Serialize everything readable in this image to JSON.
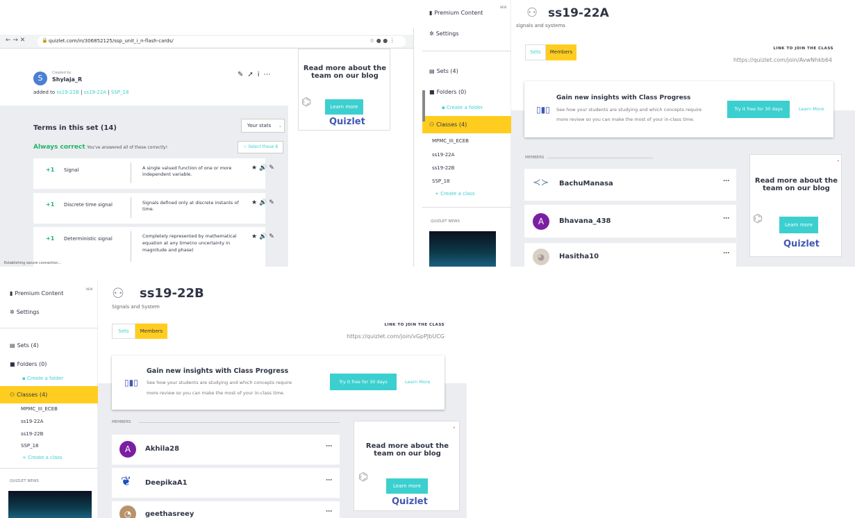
{
  "p1": {
    "url": "quizlet.com/in/306852125/ssp_unit_i_n-flash-cards/",
    "created_by": "Created by",
    "author": "Shylaja_R",
    "author_initial": "S",
    "added_to": "added to",
    "class_links": [
      "ss19-22B",
      "ss19-22A",
      "SSP_18"
    ],
    "terms_title": "Terms in this set (14)",
    "your_stats": "Your stats",
    "always_correct": "Always correct",
    "always_correct_msg": "You've answered all of these correctly!",
    "select_these": "Select these 8",
    "terms": [
      {
        "score": "+1",
        "term": "Signal",
        "def": "A single valued function of one or more independent variable."
      },
      {
        "score": "+1",
        "term": "Discrete time signal",
        "def": "Signals defined only at discrete instants of time."
      },
      {
        "score": "+1",
        "term": "Deterministic signal",
        "def": "Completely represented by mathematical equation at any time(no uncertainty in magnitude and phase)"
      }
    ],
    "status": "Establishing secure connection..."
  },
  "ad": {
    "line1": "Read more about the",
    "line2": "team on our blog",
    "learn": "Learn more",
    "brand": "Quizlet"
  },
  "sidebar": {
    "premium": "Premium Content",
    "new": "NEW",
    "settings": "Settings",
    "sets": "Sets (4)",
    "folders": "Folders (0)",
    "create_folder": "Create a folder",
    "classes": "Classes (4)",
    "class_list": [
      "MPMC_III_ECEB",
      "ss19-22A",
      "ss19-22B",
      "SSP_18"
    ],
    "create_class": "Create a class",
    "news": "QUIZLET NEWS"
  },
  "c1": {
    "title": "ss19-22A",
    "subtitle": "signals and systems",
    "sets": "Sets",
    "members": "Members",
    "join_label": "LINK TO JOIN THE CLASS",
    "join_url": "https://quizlet.com/join/AvwNhkb64",
    "banner_title": "Gain new insights with Class Progress",
    "banner_text1": "See how your students are studying and which concepts require",
    "banner_text2": "more review so you can make the most of your in-class time.",
    "try": "Try it free for 30 days",
    "learn_more": "Learn More",
    "members_label": "MEMBERS",
    "member_list": [
      {
        "name": "BachuManasa",
        "init": ""
      },
      {
        "name": "Bhavana_438",
        "init": "A"
      },
      {
        "name": "Hasitha10",
        "init": ""
      }
    ]
  },
  "c2": {
    "title": "ss19-22B",
    "subtitle": "Signals and System",
    "sets": "Sets",
    "members": "Members",
    "join_label": "LINK TO JOIN THE CLASS",
    "join_url": "https://quizlet.com/join/vGpPJbUCG",
    "banner_title": "Gain new insights with Class Progress",
    "banner_text1": "See how your students are studying and which concepts require",
    "banner_text2": "more review so you can make the most of your in-class time.",
    "try": "Try it free for 30 days",
    "learn_more": "Learn More",
    "members_label": "MEMBERS",
    "member_list": [
      {
        "name": "Akhila28",
        "init": "A"
      },
      {
        "name": "DeepikaA1",
        "init": ""
      },
      {
        "name": "geethasreey",
        "init": ""
      }
    ]
  },
  "colors": {
    "accent": "#3ccfcf",
    "yellow": "#ffcd1f",
    "purple": "#7b1fa2",
    "brand": "#4257b2",
    "green": "#23b26d"
  }
}
